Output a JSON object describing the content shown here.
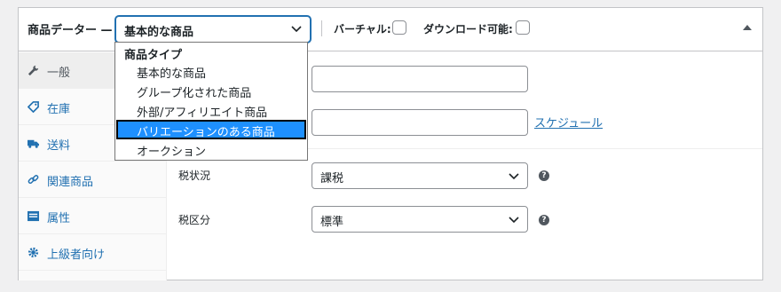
{
  "header": {
    "title": "商品データー —",
    "product_type_selected": "基本的な商品",
    "virtual_label": "バーチャル:",
    "downloadable_label": "ダウンロード可能:"
  },
  "dropdown": {
    "group_label": "商品タイプ",
    "options": [
      "基本的な商品",
      "グループ化された商品",
      "外部/アフィリエイト商品",
      "バリエーションのある商品",
      "オークション"
    ],
    "highlighted_index": 3
  },
  "tabs": [
    {
      "label": "一般",
      "icon": "wrench-icon",
      "active": true
    },
    {
      "label": "在庫",
      "icon": "tag-icon",
      "active": false
    },
    {
      "label": "送料",
      "icon": "truck-icon",
      "active": false
    },
    {
      "label": "関連商品",
      "icon": "link-icon",
      "active": false
    },
    {
      "label": "属性",
      "icon": "list-icon",
      "active": false
    },
    {
      "label": "上級者向け",
      "icon": "gear-icon",
      "active": false
    }
  ],
  "general": {
    "regular_price_value": "",
    "sale_price_value": "",
    "schedule_link": "スケジュール",
    "tax_status_label": "税状況",
    "tax_status_value": "課税",
    "tax_class_label": "税区分",
    "tax_class_value": "標準"
  },
  "colors": {
    "accent": "#2271b1",
    "highlight": "#1e90ff"
  }
}
